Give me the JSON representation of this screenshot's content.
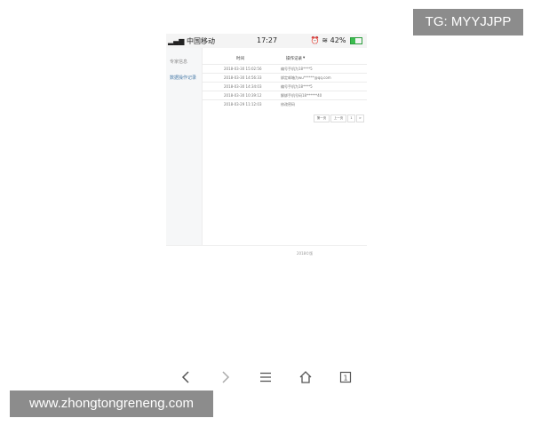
{
  "watermark_top": "TG: MYYJJPP",
  "watermark_site": "www.zhongtongreneng.com",
  "status_bar": {
    "carrier": "中国移动",
    "time": "17:27",
    "alarm_icon": "alarm-icon",
    "battery_percent": "42%",
    "battery_level": 0.42
  },
  "sidebar": {
    "items": [
      {
        "label": "专家信息"
      },
      {
        "label": "数据操作记录"
      }
    ]
  },
  "table": {
    "headers": [
      "时间",
      "操作记录"
    ],
    "rows": [
      {
        "time": "2018-03-30 15:02:56",
        "action": "编号手机为18****5"
      },
      {
        "time": "2018-03-30 14:56:33",
        "action": "绑定邮箱为wu******@qq.com"
      },
      {
        "time": "2018-03-30 14:34:03",
        "action": "编号手机为18****5"
      },
      {
        "time": "2018-03-30 10:39:12",
        "action": "解绑手机号码18******40"
      },
      {
        "time": "2018-03-29 11:12:03",
        "action": "修改密码"
      }
    ]
  },
  "pagination": {
    "first_label": "第一页",
    "prev_label": "上一页",
    "current_page": "1",
    "next_label": ">"
  },
  "footer": {
    "text": "2018©版"
  },
  "colors": {
    "sidebar_bg": "#f6f7f8",
    "active_link": "#4a7ca8",
    "battery": "#3bbd4f"
  }
}
